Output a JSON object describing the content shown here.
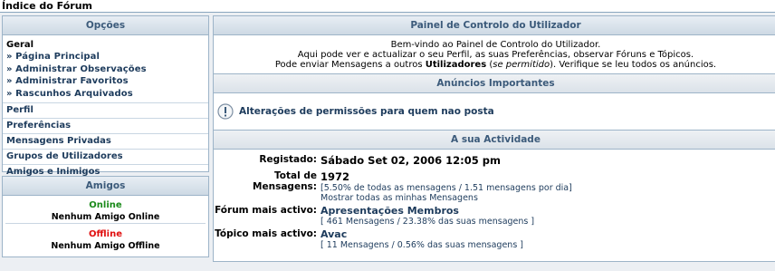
{
  "page": {
    "title": "Índice do Fórum"
  },
  "options": {
    "header": "Opções",
    "general": {
      "title": "Geral",
      "items": [
        "» Página Principal",
        "» Administrar Observações",
        "» Administrar Favoritos",
        "» Rascunhos Arquivados"
      ]
    },
    "links": [
      "Perfil",
      "Preferências",
      "Mensagens Privadas",
      "Grupos de Utilizadores",
      "Amigos e Inimigos"
    ],
    "selected_link": "Preferências"
  },
  "friends": {
    "header": "Amigos",
    "online_label": "Online",
    "online_text": "Nenhum Amigo Online",
    "offline_label": "Offline",
    "offline_text": "Nenhum Amigo Offline",
    "colors": {
      "online": "#1a8a1a",
      "offline": "#e01010"
    }
  },
  "ucp": {
    "header": "Painel de Controlo do Utilizador",
    "welcome_line1": "Bem-vindo ao Painel de Controlo do Utilizador.",
    "welcome_line2": "Aqui pode ver e actualizar o seu Perfil, as suas Preferências, observar Fóruns e Tópicos.",
    "welcome_line3_a": "Pode enviar Mensagens a outros ",
    "welcome_line3_b": "Utilizadores",
    "welcome_line3_c": " (",
    "welcome_line3_d": "se permitido",
    "welcome_line3_e": "). Verifique se leu todos os anúncios."
  },
  "announcements": {
    "header": "Anúncios Importantes",
    "icon": "info-icon",
    "text": "Alterações de permissões para quem nao posta"
  },
  "activity": {
    "header": "A sua Actividade",
    "registered_label": "Registado:",
    "registered_value": "Sábado Set 02, 2006 12:05 pm",
    "posts_label": "Total de Mensagens:",
    "posts_value": "1972",
    "posts_sub": "[5.50% de todas as mensagens / 1.51 mensagens por dia]",
    "posts_link": "Mostrar todas as minhas Mensagens",
    "forum_label": "Fórum mais activo:",
    "forum_value": "Apresentações Membros",
    "forum_sub": "[ 461 Mensagens / 23.38% das suas mensagens ]",
    "topic_label": "Tópico mais activo:",
    "topic_value": "Avac",
    "topic_sub": "[ 11 Mensagens / 0.56% das suas mensagens ]"
  }
}
